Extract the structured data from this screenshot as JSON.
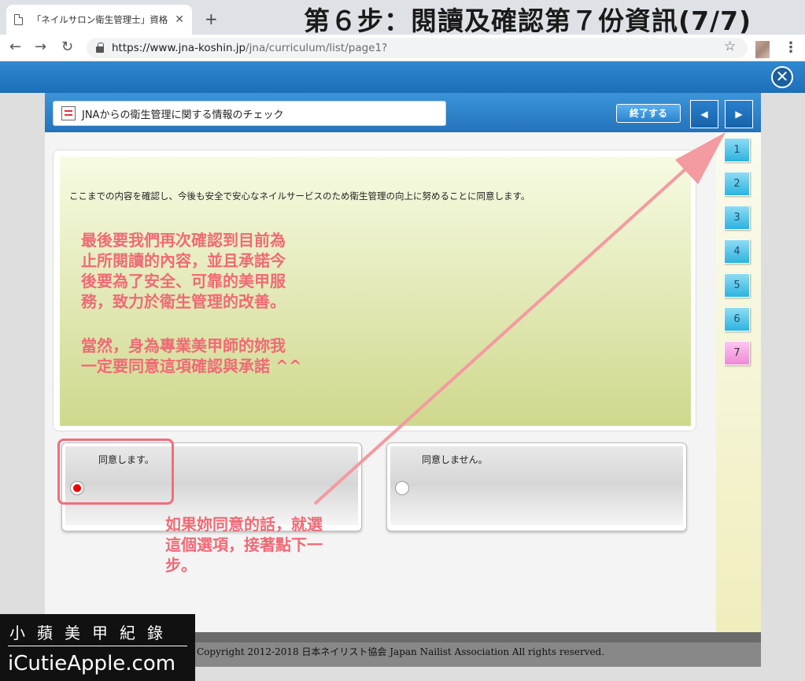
{
  "browser": {
    "tab_title": "「ネイルサロン衛生管理士」資格",
    "tab_close": "✕",
    "new_tab": "+",
    "back": "←",
    "forward": "→",
    "reload": "↻",
    "url_host": "https://www.jna-koshin.jp",
    "url_path": "/jna/curriculum/list/page1?",
    "star": "☆",
    "menu": "⋮"
  },
  "step_title": "第６步：閱讀及確認第７份資訊(7/7)",
  "app": {
    "close_symbol": "✕",
    "lesson_title": "JNAからの衛生管理に関する情報のチェック",
    "end_label": "終了する",
    "prev_symbol": "◀",
    "next_symbol": "▶",
    "content_text": "ここまでの内容を確認し、今後も安全で安心なネイルサービスのため衛生管理の向上に努めることに同意します。",
    "choices": [
      {
        "label": "同意します。",
        "selected": true
      },
      {
        "label": "同意しません。",
        "selected": false
      }
    ],
    "pages": [
      "1",
      "2",
      "3",
      "4",
      "5",
      "6",
      "7"
    ],
    "current_page": "7",
    "footer": "Copyright 2012-2018 日本ネイリスト協会 Japan Nailist Association All rights reserved."
  },
  "annotations": {
    "note1_lines": [
      "最後要我們再次確認到目前為",
      "止所閱讀的內容，並且承諾今",
      "後要為了安全、可靠的美甲服",
      "務，致力於衛生管理的改善。"
    ],
    "note2_lines": [
      "當然，身為專業美甲師的妳我",
      "一定要同意這項確認與承諾 ^^"
    ],
    "note3_lines": [
      "如果妳同意的話，就選",
      "這個選項，接著點下一",
      "步。"
    ],
    "color": "#f06a75"
  },
  "watermark": {
    "line1": "小蘋美甲紀錄",
    "line2": "iCutieApple.com"
  }
}
